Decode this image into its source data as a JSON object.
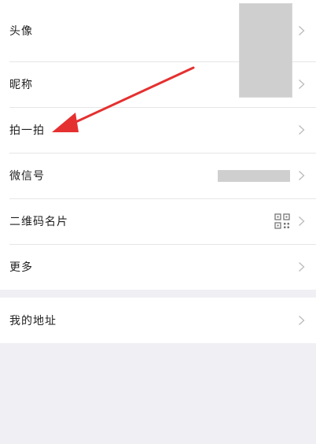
{
  "profile": {
    "items": [
      {
        "label": "头像"
      },
      {
        "label": "昵称"
      },
      {
        "label": "拍一拍"
      },
      {
        "label": "微信号"
      },
      {
        "label": "二维码名片"
      },
      {
        "label": "更多"
      }
    ]
  },
  "address": {
    "label": "我的地址"
  },
  "annotation": {
    "color": "#e53030"
  },
  "placeholder_color": "#cfcfcf"
}
